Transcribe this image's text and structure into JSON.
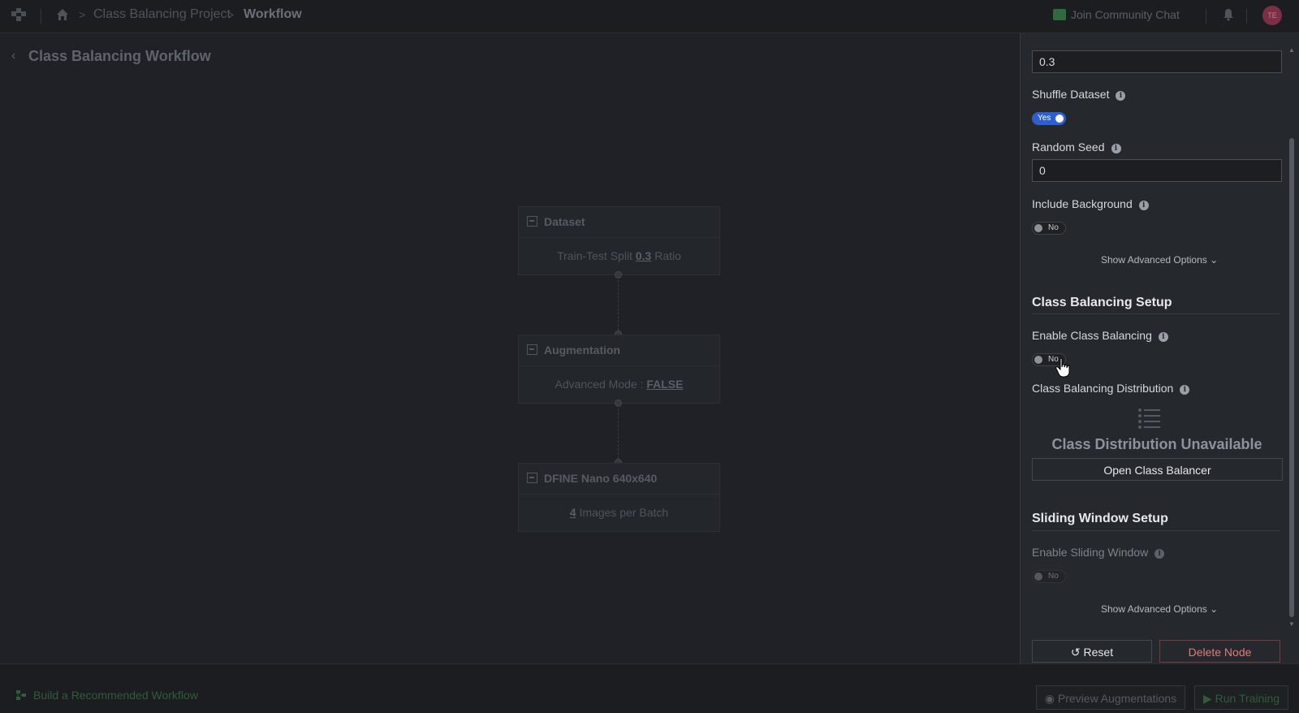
{
  "topbar": {
    "breadcrumb": [
      "Class Balancing Project",
      "Workflow"
    ],
    "community_label": "Join Community Chat",
    "avatar_initials": "TE"
  },
  "page": {
    "title": "Class Balancing Workflow"
  },
  "workflow": {
    "nodes": [
      {
        "title": "Dataset",
        "body_prefix": "Train-Test Split ",
        "body_value": "0.3",
        "body_suffix": " Ratio"
      },
      {
        "title": "Augmentation",
        "body_prefix": "Advanced Mode : ",
        "body_value": "FALSE",
        "body_suffix": ""
      },
      {
        "title": "DFINE Nano 640x640",
        "body_prefix": "",
        "body_value": "4",
        "body_suffix": " Images per Batch"
      }
    ]
  },
  "panel": {
    "split_value": "0.3",
    "shuffle_label": "Shuffle Dataset",
    "shuffle_value": "Yes",
    "seed_label": "Random Seed",
    "seed_value": "0",
    "background_label": "Include Background",
    "background_value": "No",
    "advanced_label": "Show Advanced Options",
    "class_balancing": {
      "section_title": "Class Balancing Setup",
      "enable_label": "Enable Class Balancing",
      "enable_value": "No",
      "distribution_label": "Class Balancing Distribution",
      "unavailable_text": "Class Distribution Unavailable",
      "open_button": "Open Class Balancer"
    },
    "sliding_window": {
      "section_title": "Sliding Window Setup",
      "enable_label": "Enable Sliding Window",
      "enable_value": "No",
      "advanced_label": "Show Advanced Options"
    },
    "reset_button": "Reset",
    "delete_button": "Delete Node"
  },
  "bottombar": {
    "build_link": "Build a Recommended Workflow",
    "preview_button": "Preview Augmentations",
    "run_button": "Run Training"
  },
  "colors": {
    "accent_blue": "#2f5fcf",
    "danger": "#e27a7a",
    "success_green": "#2f5c39"
  }
}
